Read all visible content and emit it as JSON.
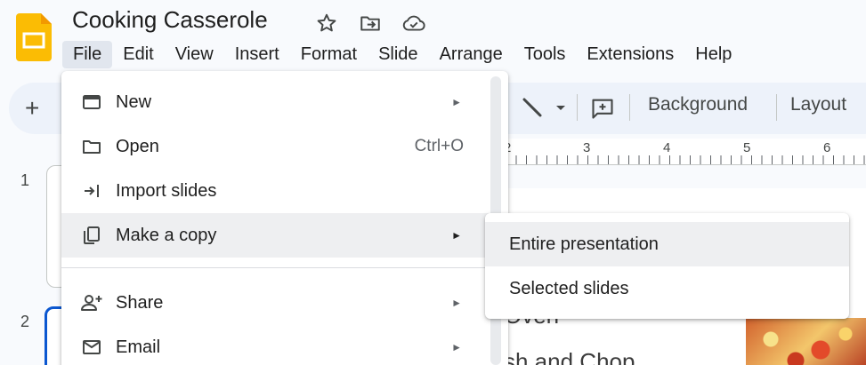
{
  "document": {
    "title": "Cooking Casserole"
  },
  "title_icons": [
    "star-icon",
    "move-to-folder-icon",
    "cloud-saved-icon"
  ],
  "menubar": {
    "items": [
      "File",
      "Edit",
      "View",
      "Insert",
      "Format",
      "Slide",
      "Arrange",
      "Tools",
      "Extensions",
      "Help"
    ],
    "active": "File"
  },
  "toolbar": {
    "new_slide_symbol": "+",
    "background_label": "Background",
    "layout_label": "Layout"
  },
  "ruler": {
    "numbers": [
      "2",
      "3",
      "4",
      "5",
      "6"
    ]
  },
  "filmstrip": {
    "slide_numbers": [
      "1",
      "2"
    ],
    "selected": "2"
  },
  "slide": {
    "text_lines": [
      "Oven",
      "sh and Chop"
    ]
  },
  "file_menu": {
    "items": [
      {
        "label": "New",
        "icon": "new-window-icon",
        "submenu": true
      },
      {
        "label": "Open",
        "icon": "folder-icon",
        "shortcut": "Ctrl+O"
      },
      {
        "label": "Import slides",
        "icon": "import-icon"
      },
      {
        "label": "Make a copy",
        "icon": "copy-icon",
        "submenu": true,
        "highlighted": true
      },
      {
        "label": "Share",
        "icon": "person-add-icon",
        "submenu": true
      },
      {
        "label": "Email",
        "icon": "email-icon",
        "submenu": true
      }
    ],
    "submenu_arrow": "►"
  },
  "copy_submenu": {
    "items": [
      "Entire presentation",
      "Selected slides"
    ],
    "highlighted": "Entire presentation"
  },
  "colors": {
    "accent": "#0b57d0",
    "logo": "#fbbc04",
    "menu_hover": "#eeeff1",
    "toolbar_bg": "#edf2fa"
  }
}
